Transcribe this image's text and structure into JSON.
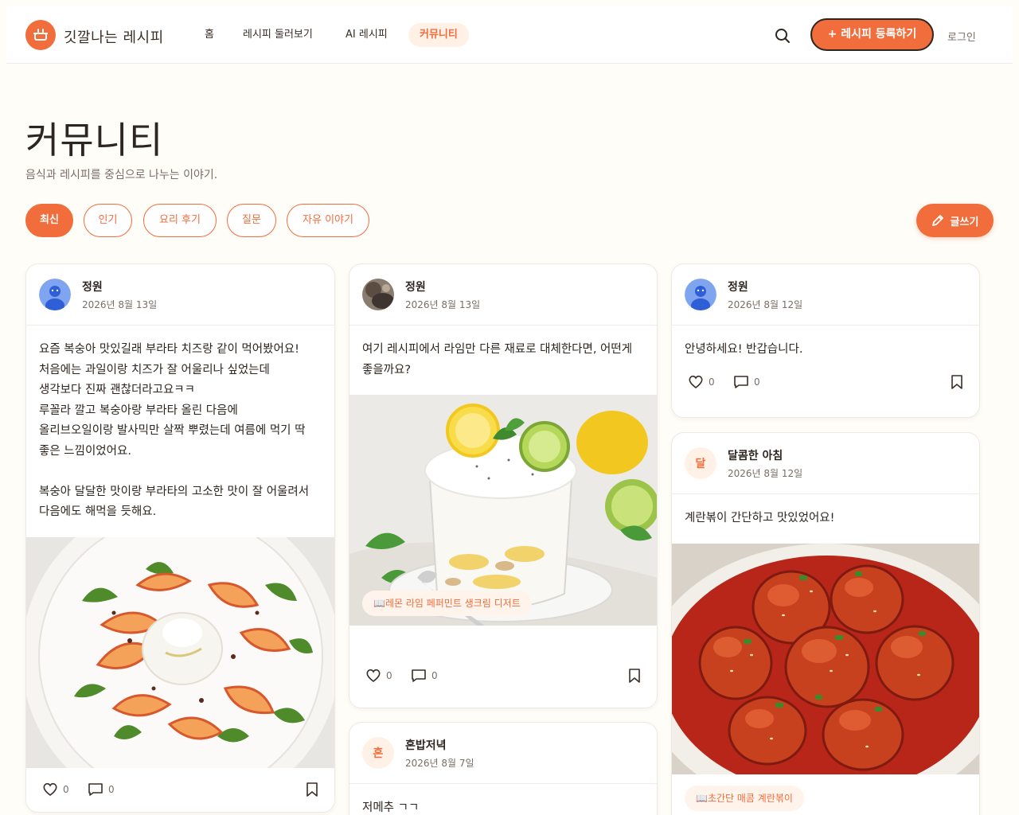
{
  "header": {
    "logo_text": "깃깔나는 레시피",
    "nav": [
      {
        "label": "홈",
        "active": false
      },
      {
        "label": "레시피 둘러보기",
        "active": false
      },
      {
        "label": "AI 레시피",
        "active": false
      },
      {
        "label": "커뮤니티",
        "active": true
      }
    ],
    "cta_label": "+ 레시피 등록하기",
    "login_label": "로그인",
    "search_icon": "search-icon"
  },
  "page": {
    "title": "커뮤니티",
    "subtitle": "음식과 레시피를 중심으로 나누는 이야기."
  },
  "filters": [
    {
      "label": "최신",
      "active": true
    },
    {
      "label": "인기",
      "active": false
    },
    {
      "label": "요리 후기",
      "active": false
    },
    {
      "label": "질문",
      "active": false
    },
    {
      "label": "자유 이야기",
      "active": false
    }
  ],
  "write_label": "글쓰기",
  "posts": [
    {
      "author": "정원",
      "date": "2026년 8월 13일",
      "avatar": "blue-user-avatar",
      "text": "요즘 복숭아 맛있길래 부라타 치즈랑 같이 먹어봤어요!\n처음에는 과일이랑 치즈가 잘 어울리나 싶었는데\n생각보다 진짜 괜찮더라고요ㅋㅋ\n루꼴라 깔고 복숭아랑 부라타 올린 다음에\n올리브오일이랑 발사믹만 살짝 뿌렸는데 여름에 먹기 딱\n좋은 느낌이었어요.\n\n복숭아 달달한 맛이랑 부라타의 고소한 맛이 잘 어울려서\n다음에도 해먹을 듯해요.",
      "image": "peach-burrata-salad-photo",
      "likes": "0",
      "comments": "0"
    },
    {
      "author": "정원",
      "date": "2026년 8월 13일",
      "avatar": "photo-avatar",
      "text": "여기 레시피에서 라임만 다른 재료로 대체한다면, 어떤게\n좋을까요?",
      "image": "lemon-lime-cream-dessert-photo",
      "recipe_tag": "📖레몬 라임 페퍼민트 생크림 디저트",
      "likes": "0",
      "comments": "0"
    },
    {
      "author": "혼밥저녁",
      "date": "2026년 8월 7일",
      "avatar_letter": "혼",
      "text": "저메추 ㄱㄱ"
    },
    {
      "author": "정원",
      "date": "2026년 8월 12일",
      "avatar": "blue-user-avatar",
      "text": "안녕하세요! 반갑습니다.",
      "likes": "0",
      "comments": "0"
    },
    {
      "author": "달콤한 아침",
      "date": "2026년 8월 12일",
      "avatar_letter": "달",
      "text": "계란볶이 간단하고 맛있었어요!",
      "image": "spicy-egg-stir-fry-photo",
      "recipe_tag": "📖초간단 매콤 계란볶이"
    }
  ],
  "colors": {
    "accent": "#f26d3c",
    "background": "#fffdf8",
    "text": "#2d2520",
    "muted": "#7a6e66"
  }
}
